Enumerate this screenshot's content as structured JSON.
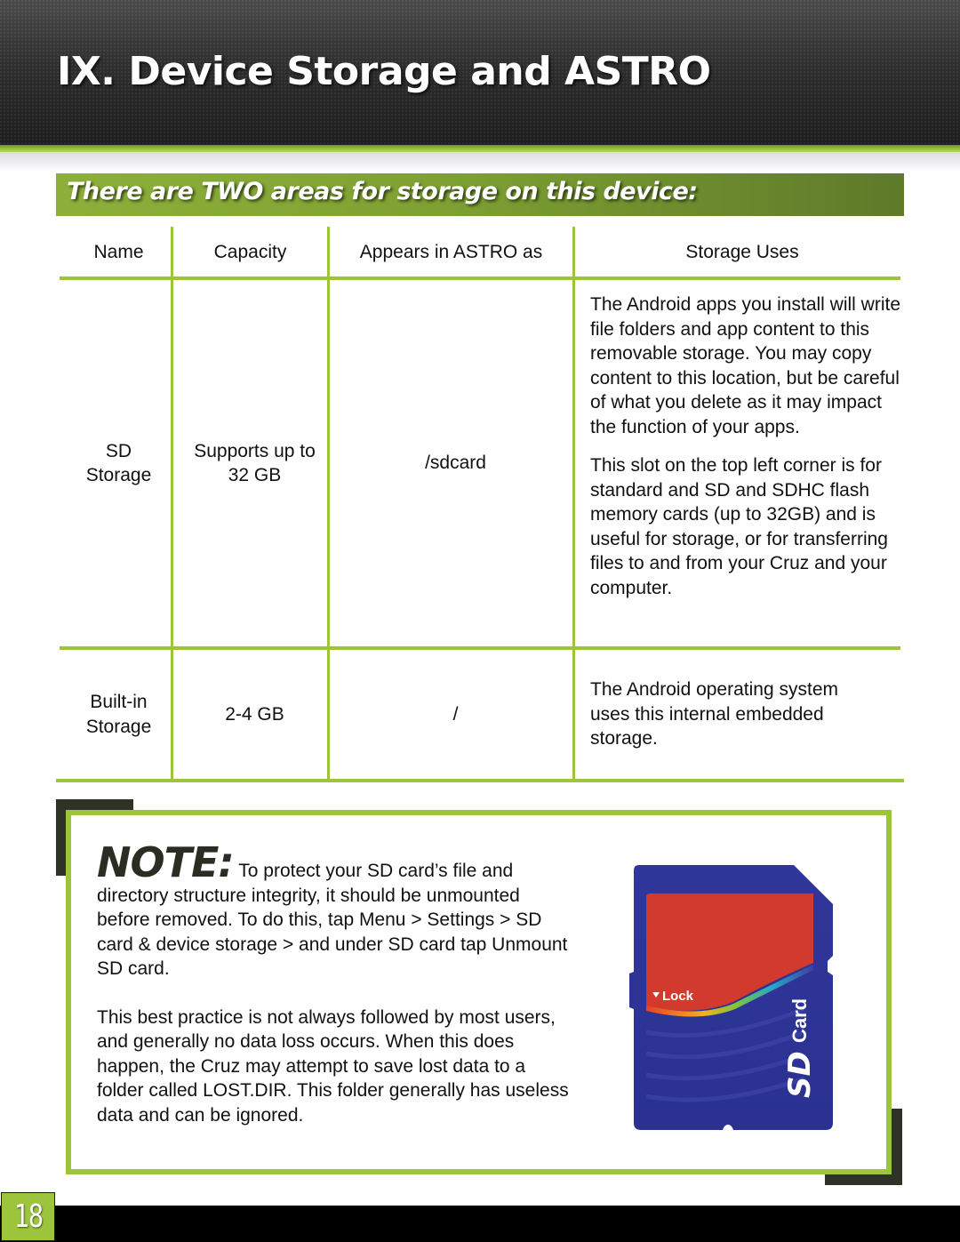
{
  "header": {
    "title": "IX. Device Storage and ASTRO"
  },
  "subtitle": "There are TWO areas for storage on this device:",
  "table": {
    "columns": [
      "Name",
      "Capacity",
      "Appears in ASTRO as",
      "Storage Uses"
    ],
    "rows": [
      {
        "name": [
          "SD",
          "Storage"
        ],
        "capacity": [
          "Supports up to",
          "32 GB"
        ],
        "astro": "/sdcard",
        "uses": [
          "The Android apps you install will write file folders and app content to this removable storage. You may copy content to this location, but be careful of what you delete as it may impact the function of your apps.",
          "This slot on the top left corner is for standard and SD and SDHC flash memory cards (up to 32GB) and is useful for storage, or for transferring files to and from your Cruz and your computer."
        ]
      },
      {
        "name": [
          "Built-in",
          "Storage"
        ],
        "capacity": [
          "2-4 GB"
        ],
        "astro": "/",
        "uses": [
          "The Android operating system uses this internal embedded storage."
        ]
      }
    ]
  },
  "note": {
    "label": "NOTE:",
    "paragraph1": "To protect your SD card’s file and directory structure integrity, it should be unmounted before removed. To do this, tap Menu > Settings > SD card & device storage > and under SD card tap Unmount SD card.",
    "paragraph2": "This best practice is not always followed by most users, and generally no data loss occurs. When this does happen, the Cruz may attempt to save lost data to a folder called LOST.DIR. This folder generally has useless data and can be ignored."
  },
  "sd_card_image": {
    "lock_label": "Lock",
    "brand_label": "SD",
    "card_label": "Card",
    "icon": "sd-card-icon"
  },
  "footer": {
    "page_number": "18"
  },
  "colors": {
    "accent_green": "#9cc43c",
    "dark_olive": "#2f3226",
    "header_dark": "#1d1d1d",
    "sd_blue": "#2e3592",
    "sd_red": "#d13a2c"
  }
}
